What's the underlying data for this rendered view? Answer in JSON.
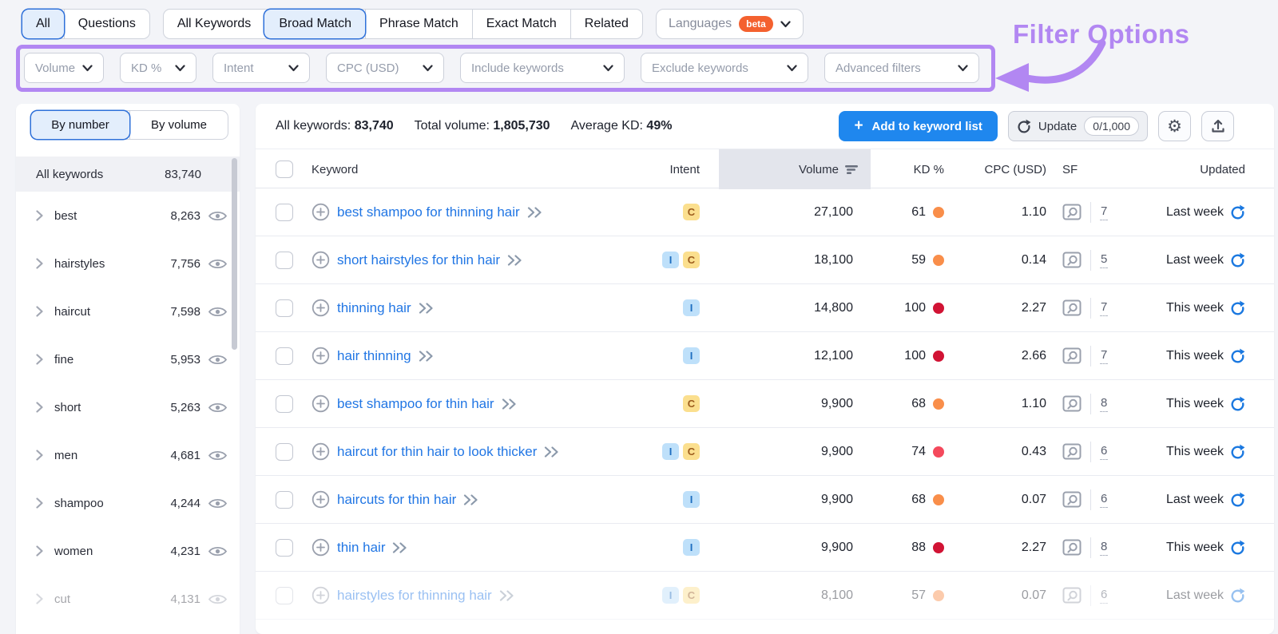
{
  "toolbar": {
    "scope_tabs": [
      {
        "label": "All",
        "selected": true
      },
      {
        "label": "Questions",
        "selected": false
      }
    ],
    "match_tabs": [
      {
        "label": "All Keywords",
        "selected": false
      },
      {
        "label": "Broad Match",
        "selected": true
      },
      {
        "label": "Phrase Match",
        "selected": false
      },
      {
        "label": "Exact Match",
        "selected": false
      },
      {
        "label": "Related",
        "selected": false
      }
    ],
    "languages_label": "Languages",
    "languages_badge": "beta"
  },
  "filters": {
    "items": [
      "Volume",
      "KD %",
      "Intent",
      "CPC (USD)",
      "Include keywords",
      "Exclude keywords",
      "Advanced filters"
    ]
  },
  "annotation": {
    "label": "Filter Options"
  },
  "sidebar": {
    "tabs": [
      {
        "label": "By number",
        "selected": true
      },
      {
        "label": "By volume",
        "selected": false
      }
    ],
    "header": {
      "label": "All keywords",
      "count": "83,740"
    },
    "groups": [
      {
        "label": "best",
        "count": "8,263"
      },
      {
        "label": "hairstyles",
        "count": "7,756"
      },
      {
        "label": "haircut",
        "count": "7,598"
      },
      {
        "label": "fine",
        "count": "5,953"
      },
      {
        "label": "short",
        "count": "5,263"
      },
      {
        "label": "men",
        "count": "4,681"
      },
      {
        "label": "shampoo",
        "count": "4,244"
      },
      {
        "label": "women",
        "count": "4,231"
      },
      {
        "label": "cut",
        "count": "4,131",
        "faded": true
      }
    ]
  },
  "summary": {
    "stats": [
      {
        "label": "All keywords:",
        "value": "83,740"
      },
      {
        "label": "Total volume:",
        "value": "1,805,730"
      },
      {
        "label": "Average KD:",
        "value": "49%"
      }
    ],
    "add_button_label": "Add to keyword list",
    "update_button_label": "Update",
    "update_count": "0/1,000"
  },
  "table": {
    "columns": [
      "Keyword",
      "Intent",
      "Volume",
      "KD %",
      "CPC (USD)",
      "SF",
      "Updated"
    ],
    "rows": [
      {
        "keyword": "best shampoo for thinning hair",
        "intents": [
          "C"
        ],
        "volume": "27,100",
        "kd": "61",
        "kd_level": "orange",
        "cpc": "1.10",
        "sf": "7",
        "updated": "Last week"
      },
      {
        "keyword": "short hairstyles for thin hair",
        "intents": [
          "I",
          "C"
        ],
        "volume": "18,100",
        "kd": "59",
        "kd_level": "orange",
        "cpc": "0.14",
        "sf": "5",
        "updated": "Last week"
      },
      {
        "keyword": "thinning hair",
        "intents": [
          "I"
        ],
        "volume": "14,800",
        "kd": "100",
        "kd_level": "red",
        "cpc": "2.27",
        "sf": "7",
        "updated": "This week"
      },
      {
        "keyword": "hair thinning",
        "intents": [
          "I"
        ],
        "volume": "12,100",
        "kd": "100",
        "kd_level": "red",
        "cpc": "2.66",
        "sf": "7",
        "updated": "This week"
      },
      {
        "keyword": "best shampoo for thin hair",
        "intents": [
          "C"
        ],
        "volume": "9,900",
        "kd": "68",
        "kd_level": "orange",
        "cpc": "1.10",
        "sf": "8",
        "updated": "This week"
      },
      {
        "keyword": "haircut for thin hair to look thicker",
        "intents": [
          "I",
          "C"
        ],
        "volume": "9,900",
        "kd": "74",
        "kd_level": "light_red",
        "cpc": "0.43",
        "sf": "6",
        "updated": "This week"
      },
      {
        "keyword": "haircuts for thin hair",
        "intents": [
          "I"
        ],
        "volume": "9,900",
        "kd": "68",
        "kd_level": "orange",
        "cpc": "0.07",
        "sf": "6",
        "updated": "Last week"
      },
      {
        "keyword": "thin hair",
        "intents": [
          "I"
        ],
        "volume": "9,900",
        "kd": "88",
        "kd_level": "red",
        "cpc": "2.27",
        "sf": "8",
        "updated": "This week"
      },
      {
        "keyword": "hairstyles for thinning hair",
        "intents": [
          "I",
          "C"
        ],
        "volume": "8,100",
        "kd": "57",
        "kd_level": "orange",
        "cpc": "0.07",
        "sf": "6",
        "updated": "Last week",
        "faded": true
      }
    ]
  },
  "icons": {
    "plus": "+",
    "gear": "⚙"
  },
  "colors": {
    "purple": "#b287f2",
    "accent_blue": "#1f87ee",
    "link_blue": "#2176e4",
    "refresh_blue": "#1a78e0",
    "selected_bg": "#e3eefc",
    "selected_border": "#2e70d9",
    "beta_orange": "#f4612f",
    "kd": {
      "orange": "#f98e4a",
      "light_red": "#f4495c",
      "red": "#d11334"
    },
    "intent": {
      "I": {
        "bg": "#bee0fa",
        "fg": "#1e6ec0"
      },
      "C": {
        "bg": "#fbdf8e",
        "fg": "#9c5c1d"
      }
    }
  }
}
